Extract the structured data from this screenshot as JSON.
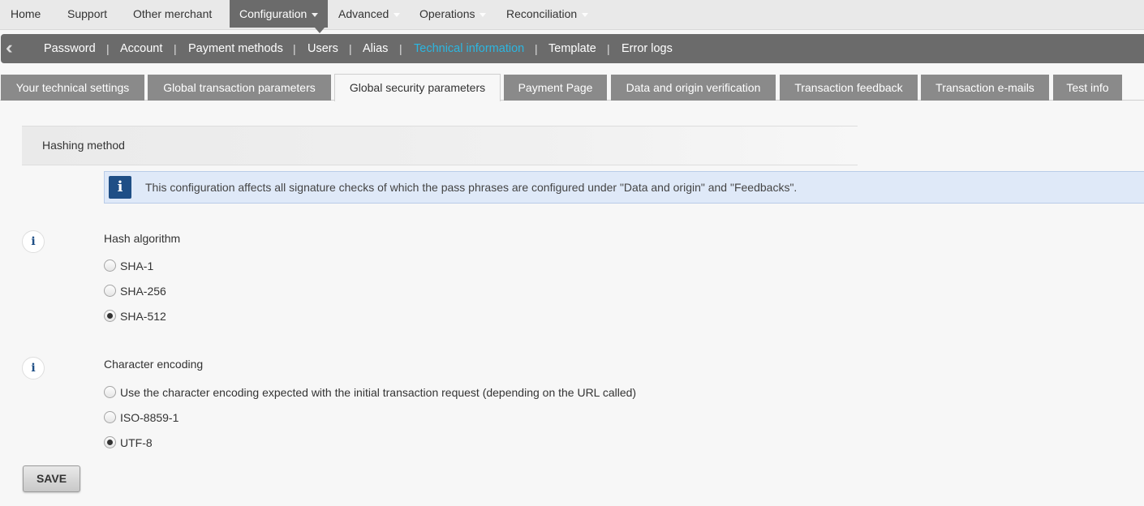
{
  "top_menu": {
    "items": [
      {
        "label": "Home"
      },
      {
        "label": "Support"
      },
      {
        "label": "Other merchant"
      },
      {
        "label": "Configuration"
      },
      {
        "label": "Advanced"
      },
      {
        "label": "Operations"
      },
      {
        "label": "Reconciliation"
      }
    ],
    "active": "Configuration"
  },
  "sub_nav": {
    "back_icon": "double-chevron-left",
    "links": [
      {
        "label": "Password"
      },
      {
        "label": "Account"
      },
      {
        "label": "Payment methods"
      },
      {
        "label": "Users"
      },
      {
        "label": "Alias"
      },
      {
        "label": "Technical information"
      },
      {
        "label": "Template"
      },
      {
        "label": "Error logs"
      }
    ],
    "separator": "|",
    "current": "Technical information",
    "current_color": "#2cb6e0"
  },
  "tabs": [
    {
      "label": "Your technical settings"
    },
    {
      "label": "Global transaction parameters"
    },
    {
      "label": "Global security parameters"
    },
    {
      "label": "Payment Page"
    },
    {
      "label": "Data and origin verification"
    },
    {
      "label": "Transaction feedback"
    },
    {
      "label": "Transaction e-mails"
    },
    {
      "label": "Test info"
    }
  ],
  "active_tab": "Global security parameters",
  "section": {
    "title": "Hashing method",
    "notice": {
      "icon": "info-icon",
      "text": "This configuration affects all signature checks of which the pass phrases are configured under \"Data and origin\" and \"Feedbacks\"."
    }
  },
  "hash_algorithm": {
    "label": "Hash algorithm",
    "options": [
      {
        "label": "SHA-1",
        "checked": false
      },
      {
        "label": "SHA-256",
        "checked": false
      },
      {
        "label": "SHA-512",
        "checked": true
      }
    ]
  },
  "character_encoding": {
    "label": "Character encoding",
    "options": [
      {
        "label": "Use the character encoding expected with the initial transaction request (depending on the URL called)",
        "checked": false
      },
      {
        "label": "ISO-8859-1",
        "checked": false
      },
      {
        "label": "UTF-8",
        "checked": true
      }
    ]
  },
  "save_button": {
    "label": "SAVE"
  },
  "colors": {
    "menu_bg": "#e9e9e9",
    "subnav_bg": "#6b6b6b",
    "tab_bg": "#8a8a8a",
    "info_bg": "#dfe9f8",
    "info_icon_bg": "#1f4f86"
  }
}
